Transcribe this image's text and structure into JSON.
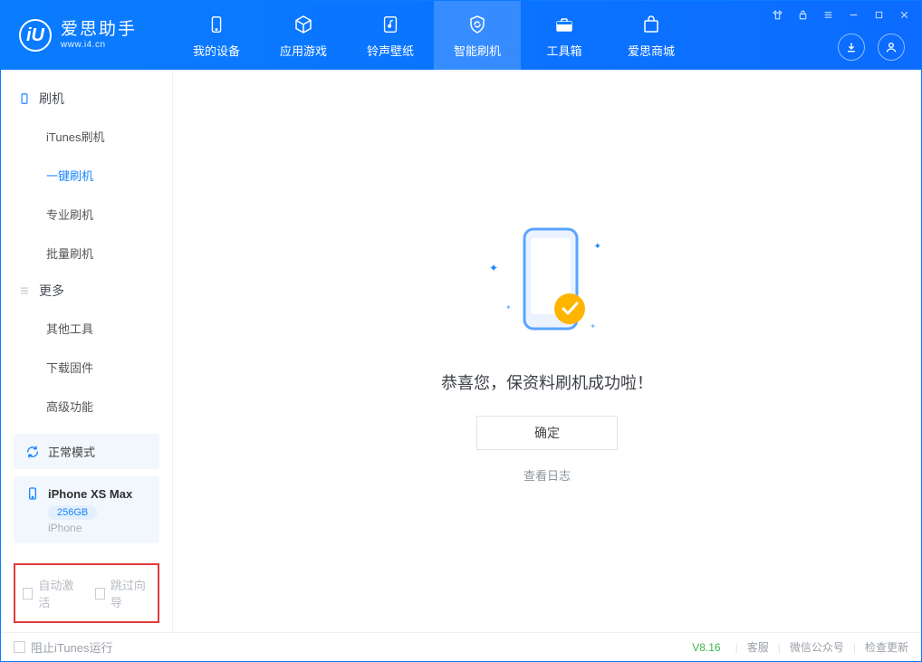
{
  "app": {
    "title": "爱思助手",
    "url": "www.i4.cn"
  },
  "nav": {
    "tabs": [
      {
        "label": "我的设备",
        "icon": "device-icon"
      },
      {
        "label": "应用游戏",
        "icon": "cube-icon"
      },
      {
        "label": "铃声壁纸",
        "icon": "music-note-icon"
      },
      {
        "label": "智能刷机",
        "icon": "refresh-shield-icon"
      },
      {
        "label": "工具箱",
        "icon": "toolbox-icon"
      },
      {
        "label": "爱思商城",
        "icon": "store-icon"
      }
    ]
  },
  "sidebar": {
    "group1_title": "刷机",
    "group1": [
      {
        "label": "iTunes刷机"
      },
      {
        "label": "一键刷机"
      },
      {
        "label": "专业刷机"
      },
      {
        "label": "批量刷机"
      }
    ],
    "group2_title": "更多",
    "group2": [
      {
        "label": "其他工具"
      },
      {
        "label": "下载固件"
      },
      {
        "label": "高级功能"
      }
    ],
    "mode_label": "正常模式",
    "device": {
      "model": "iPhone XS Max",
      "storage": "256GB",
      "type": "iPhone"
    },
    "checkbox1": "自动激活",
    "checkbox2": "跳过向导"
  },
  "main": {
    "message": "恭喜您，保资料刷机成功啦！",
    "ok_button": "确定",
    "view_log": "查看日志"
  },
  "footer": {
    "block_itunes": "阻止iTunes运行",
    "version": "V8.16",
    "link1": "客服",
    "link2": "微信公众号",
    "link3": "检查更新"
  }
}
